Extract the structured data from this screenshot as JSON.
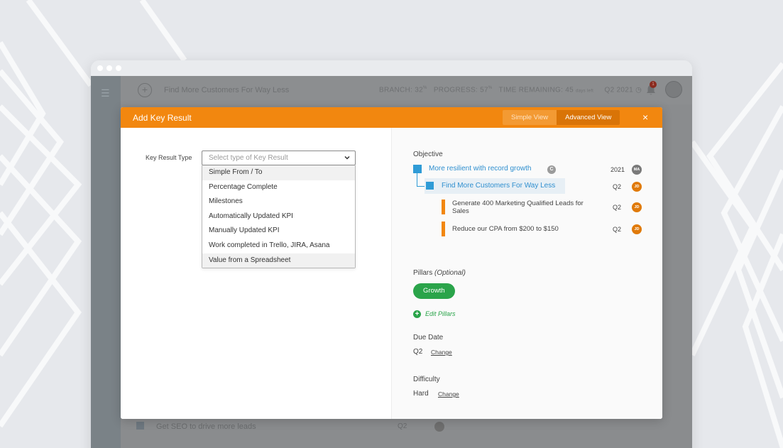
{
  "app_header": {
    "title": "Find More Customers For Way Less",
    "stats": [
      {
        "label": "BRANCH:",
        "value": "32",
        "sup": "%"
      },
      {
        "label": "PROGRESS:",
        "value": "57",
        "sup": "%"
      },
      {
        "label": "TIME REMAINING:",
        "value": "45",
        "sup": "days left"
      }
    ],
    "quarter": "Q2 2021",
    "notifications": "1"
  },
  "background_row": {
    "text": "Get SEO to drive more leads",
    "quarter": "Q2"
  },
  "modal": {
    "title": "Add Key Result",
    "views": [
      {
        "label": "Simple View",
        "active": false
      },
      {
        "label": "Advanced View",
        "active": true
      }
    ],
    "close": "×"
  },
  "key_result_type": {
    "label": "Key Result Type",
    "placeholder": "Select type of Key Result",
    "options": [
      "Simple From / To",
      "Percentage Complete",
      "Milestones",
      "Automatically Updated KPI",
      "Manually Updated KPI",
      "Work completed in Trello, JIRA, Asana",
      "Value from a Spreadsheet"
    ]
  },
  "objective": {
    "label": "Objective",
    "parent": {
      "text": "More resilient with record growth",
      "badge": "C",
      "year": "2021",
      "owner": "MA"
    },
    "current": {
      "text": "Find More Customers For Way Less",
      "quarter": "Q2",
      "owner": "JD"
    },
    "key_results": [
      {
        "text": "Generate 400 Marketing Qualified Leads for Sales",
        "quarter": "Q2",
        "owner": "JD"
      },
      {
        "text": "Reduce our CPA from $200 to $150",
        "quarter": "Q2",
        "owner": "JD"
      }
    ]
  },
  "pillars": {
    "label": "Pillars",
    "optional": "(Optional)",
    "tag": "Growth",
    "edit": "Edit Pillars"
  },
  "due_date": {
    "label": "Due Date",
    "value": "Q2",
    "change": "Change"
  },
  "difficulty": {
    "label": "Difficulty",
    "value": "Hard",
    "change": "Change"
  },
  "colors": {
    "accent": "#f2870f",
    "link": "#2f8fcf",
    "success": "#2aa44a"
  }
}
